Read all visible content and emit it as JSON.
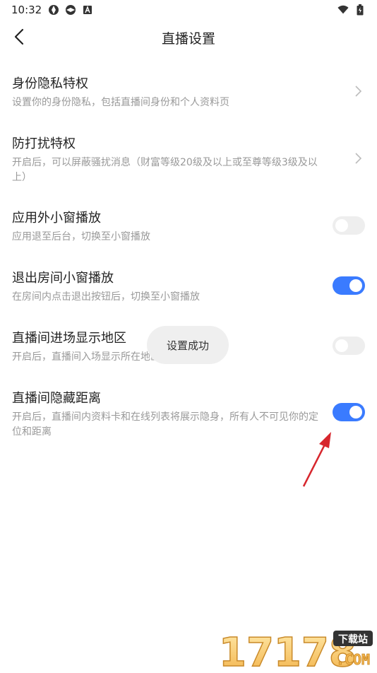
{
  "status_bar": {
    "time": "10:32"
  },
  "header": {
    "title": "直播设置"
  },
  "settings": [
    {
      "title": "身份隐私特权",
      "desc": "设置你的身份隐私，包括直播间身份和个人资料页",
      "control": "chevron"
    },
    {
      "title": "防打扰特权",
      "desc": "开启后，可以屏蔽骚扰消息（财富等级20级及以上或至尊等级3级及以上）",
      "control": "chevron"
    },
    {
      "title": "应用外小窗播放",
      "desc": "应用退至后台，切换至小窗播放",
      "control": "toggle",
      "on": false
    },
    {
      "title": "退出房间小窗播放",
      "desc": "在房间内点击退出按钮后，切换至小窗播放",
      "control": "toggle",
      "on": true
    },
    {
      "title": "直播间进场显示地区",
      "desc": "开启后，直播间入场显示所在地区",
      "control": "toggle",
      "on": false
    },
    {
      "title": "直播间隐藏距离",
      "desc": "开启后，直播间内资料卡和在线列表将展示隐身，所有人不可见你的定位和距离",
      "control": "toggle",
      "on": true
    }
  ],
  "toast": {
    "text": "设置成功"
  },
  "watermark": {
    "text": "17178",
    "badge": "下载站",
    "domain": ".COM"
  },
  "colors": {
    "accent": "#3a7bff",
    "annotation_arrow": "#d7262d"
  }
}
